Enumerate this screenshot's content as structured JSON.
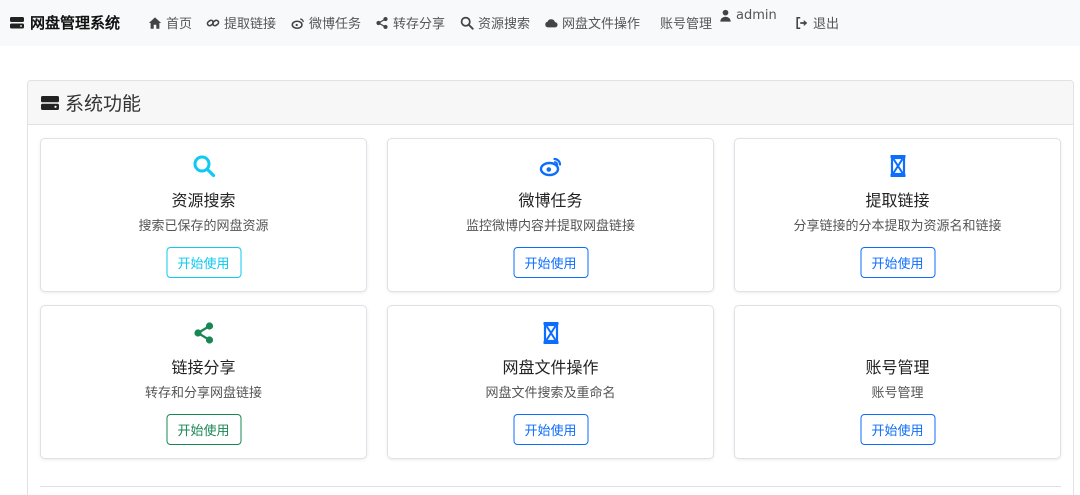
{
  "nav": {
    "brand": "网盘管理系统",
    "items": [
      {
        "label": "首页",
        "icon": "home-icon"
      },
      {
        "label": "提取链接",
        "icon": "link-icon"
      },
      {
        "label": "微博任务",
        "icon": "weibo-icon"
      },
      {
        "label": "转存分享",
        "icon": "share-icon"
      },
      {
        "label": "资源搜索",
        "icon": "search-icon"
      },
      {
        "label": "网盘文件操作",
        "icon": "cloud-icon"
      },
      {
        "label": "账号管理",
        "icon": ""
      },
      {
        "label": "admin",
        "icon": "user-icon"
      },
      {
        "label": "退出",
        "icon": "logout-icon"
      }
    ]
  },
  "section": {
    "title": "系统功能",
    "icon": "server-icon"
  },
  "features": [
    {
      "title": "资源搜索",
      "desc": "搜索已保存的网盘资源",
      "button": "开始使用",
      "icon": "search-icon",
      "color": "#0dcaf0"
    },
    {
      "title": "微博任务",
      "desc": "监控微博内容并提取网盘链接",
      "button": "开始使用",
      "icon": "weibo-icon",
      "color": "#0d6efd"
    },
    {
      "title": "提取链接",
      "desc": "分享链接的分本提取为资源名和链接",
      "button": "开始使用",
      "icon": "hourglass-icon",
      "color": "#0d6efd"
    },
    {
      "title": "链接分享",
      "desc": "转存和分享网盘链接",
      "button": "开始使用",
      "icon": "share-icon",
      "color": "#198754"
    },
    {
      "title": "网盘文件操作",
      "desc": "网盘文件搜索及重命名",
      "button": "开始使用",
      "icon": "hourglass-icon",
      "color": "#0d6efd"
    },
    {
      "title": "账号管理",
      "desc": "账号管理",
      "button": "开始使用",
      "icon": "",
      "color": "#0d6efd"
    }
  ]
}
